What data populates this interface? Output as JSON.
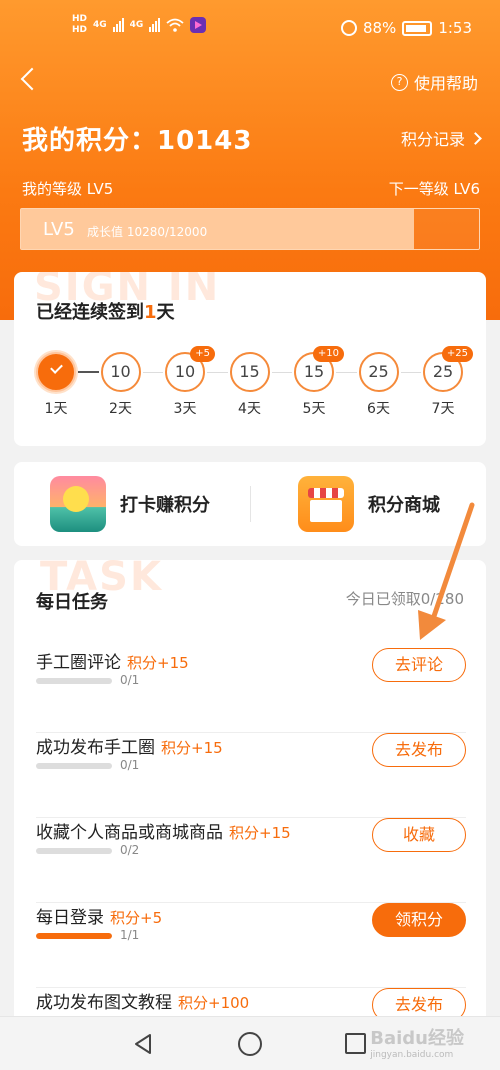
{
  "status_bar": {
    "hd1": "HD",
    "hd2": "HD",
    "net1": "4G",
    "net2": "4G",
    "battery": "88%",
    "time": "1:53"
  },
  "header": {
    "help_label": "使用帮助",
    "points_label": "我的积分：10143",
    "records_label": "积分记录",
    "current_level_label": "我的等级 LV5",
    "next_level_label": "下一等级 LV6",
    "progress_level": "LV5",
    "progress_text": "成长值 10280/12000",
    "progress_fraction": 0.857
  },
  "sign_in": {
    "watermark": "SIGN IN",
    "title_prefix": "已经连续签到",
    "streak": "1",
    "title_suffix": "天",
    "days": [
      {
        "value": "",
        "label": "1天",
        "done": true,
        "bonus": ""
      },
      {
        "value": "10",
        "label": "2天",
        "done": false,
        "bonus": ""
      },
      {
        "value": "10",
        "label": "3天",
        "done": false,
        "bonus": "+5"
      },
      {
        "value": "15",
        "label": "4天",
        "done": false,
        "bonus": ""
      },
      {
        "value": "15",
        "label": "5天",
        "done": false,
        "bonus": "+10"
      },
      {
        "value": "25",
        "label": "6天",
        "done": false,
        "bonus": ""
      },
      {
        "value": "25",
        "label": "7天",
        "done": false,
        "bonus": "+25"
      }
    ]
  },
  "actions": {
    "checkin_label": "打卡赚积分",
    "mall_label": "积分商城"
  },
  "tasks": {
    "watermark": "TASK",
    "title": "每日任务",
    "today_label": "今日已领取0/280",
    "items": [
      {
        "name": "手工圈评论",
        "points": "积分+15",
        "progress": "0/1",
        "fraction": 0,
        "button": "去评论",
        "filled": false
      },
      {
        "name": "成功发布手工圈",
        "points": "积分+15",
        "progress": "0/1",
        "fraction": 0,
        "button": "去发布",
        "filled": false
      },
      {
        "name": "收藏个人商品或商城商品",
        "points": "积分+15",
        "progress": "0/2",
        "fraction": 0,
        "button": "收藏",
        "filled": false
      },
      {
        "name": "每日登录",
        "points": "积分+5",
        "progress": "1/1",
        "fraction": 1,
        "button": "领积分",
        "filled": true
      },
      {
        "name": "成功发布图文教程",
        "points": "积分+100",
        "progress": "",
        "fraction": 0,
        "button": "去发布",
        "filled": false
      }
    ]
  },
  "watermark": {
    "brand": "Baidu经验",
    "url": "jingyan.baidu.com"
  },
  "colors": {
    "accent": "#f76c0c",
    "header_top": "#ff9a2e"
  }
}
